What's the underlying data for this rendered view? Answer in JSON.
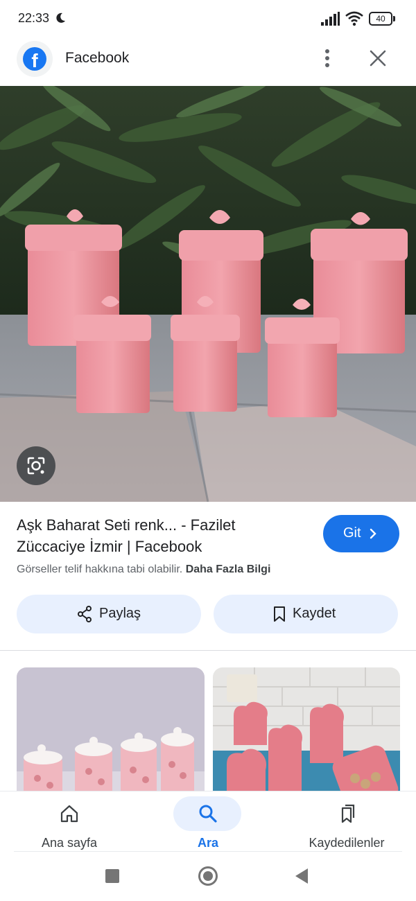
{
  "status_bar": {
    "time": "22:33",
    "battery": "40",
    "icons": [
      "moon-icon",
      "signal-icon",
      "wifi-icon",
      "battery-icon"
    ]
  },
  "header": {
    "title": "Facebook",
    "logo_letter": "f",
    "logo_icon": "facebook-icon",
    "more_icon": "more-vert-icon",
    "close_icon": "close-icon"
  },
  "main_image": {
    "lens_icon": "lens-icon"
  },
  "result": {
    "title": "Aşk Baharat Seti renk... - Fazilet Züccaciye İzmir | Facebook",
    "go_label": "Git",
    "copyright_text": "Görseller telif hakkına tabi olabilir.",
    "more_info_link": "Daha Fazla Bilgi"
  },
  "actions": {
    "share_label": "Paylaş",
    "save_label": "Kaydet"
  },
  "bottom_nav": {
    "items": [
      {
        "label": "Ana sayfa",
        "icon": "home-icon",
        "active": false
      },
      {
        "label": "Ara",
        "icon": "search-icon",
        "active": true
      },
      {
        "label": "Kaydedilenler",
        "icon": "bookmarks-icon",
        "active": false
      }
    ]
  },
  "colors": {
    "accent": "#1a73e8",
    "button_tint": "#e8f0fe",
    "facebook_blue": "#1877f2",
    "jar_pink": "#e6868f"
  }
}
